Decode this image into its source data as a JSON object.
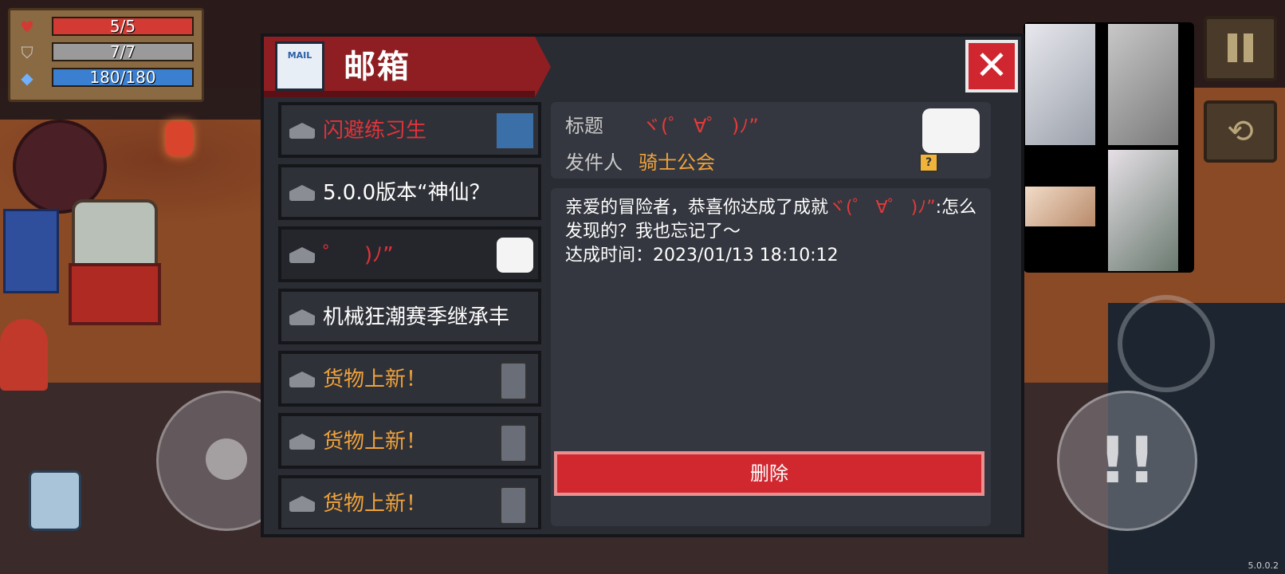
{
  "hud": {
    "hp": "5/5",
    "armor": "7/7",
    "energy": "180/180"
  },
  "mailbox": {
    "title": "邮箱",
    "icon_text": "MAIL",
    "close_label": "✕",
    "items": [
      {
        "label": "闪避练习生",
        "color": "red",
        "thumb": "dodge"
      },
      {
        "label": "5.0.0版本“神仙？",
        "color": "white",
        "thumb": "none"
      },
      {
        "label": "゜　)ﾉ”",
        "color": "red",
        "thumb": "emoji"
      },
      {
        "label": "机械狂潮赛季继承丰",
        "color": "white",
        "thumb": "none"
      },
      {
        "label": "货物上新！",
        "color": "orange",
        "thumb": "merchant"
      },
      {
        "label": "货物上新！",
        "color": "orange",
        "thumb": "merchant"
      },
      {
        "label": "货物上新！",
        "color": "orange",
        "thumb": "merchant"
      }
    ],
    "detail": {
      "title_label": "标题",
      "title_value": "ヾ(゜  ∀゜ )ﾉ”",
      "sender_label": "发件人",
      "sender_value": "骑士公会",
      "body_prefix": "亲爱的冒险者，恭喜你达成了成就",
      "body_emoticon": "ヾ(゜  ∀゜ )ﾉ”",
      "body_suffix": ":怎么发现的？我也忘记了～",
      "achieved_time": "达成时间：2023/01/13 18:10:12",
      "delete_label": "删除"
    }
  },
  "controls": {
    "attack_symbol": "!!",
    "swap_symbol": "⟲",
    "version": "5.0.0.2"
  },
  "colors": {
    "panel_header": "#8e1e22",
    "delete": "#d1272f",
    "unread_red": "#e0333a",
    "sender_orange": "#f0a23a"
  }
}
